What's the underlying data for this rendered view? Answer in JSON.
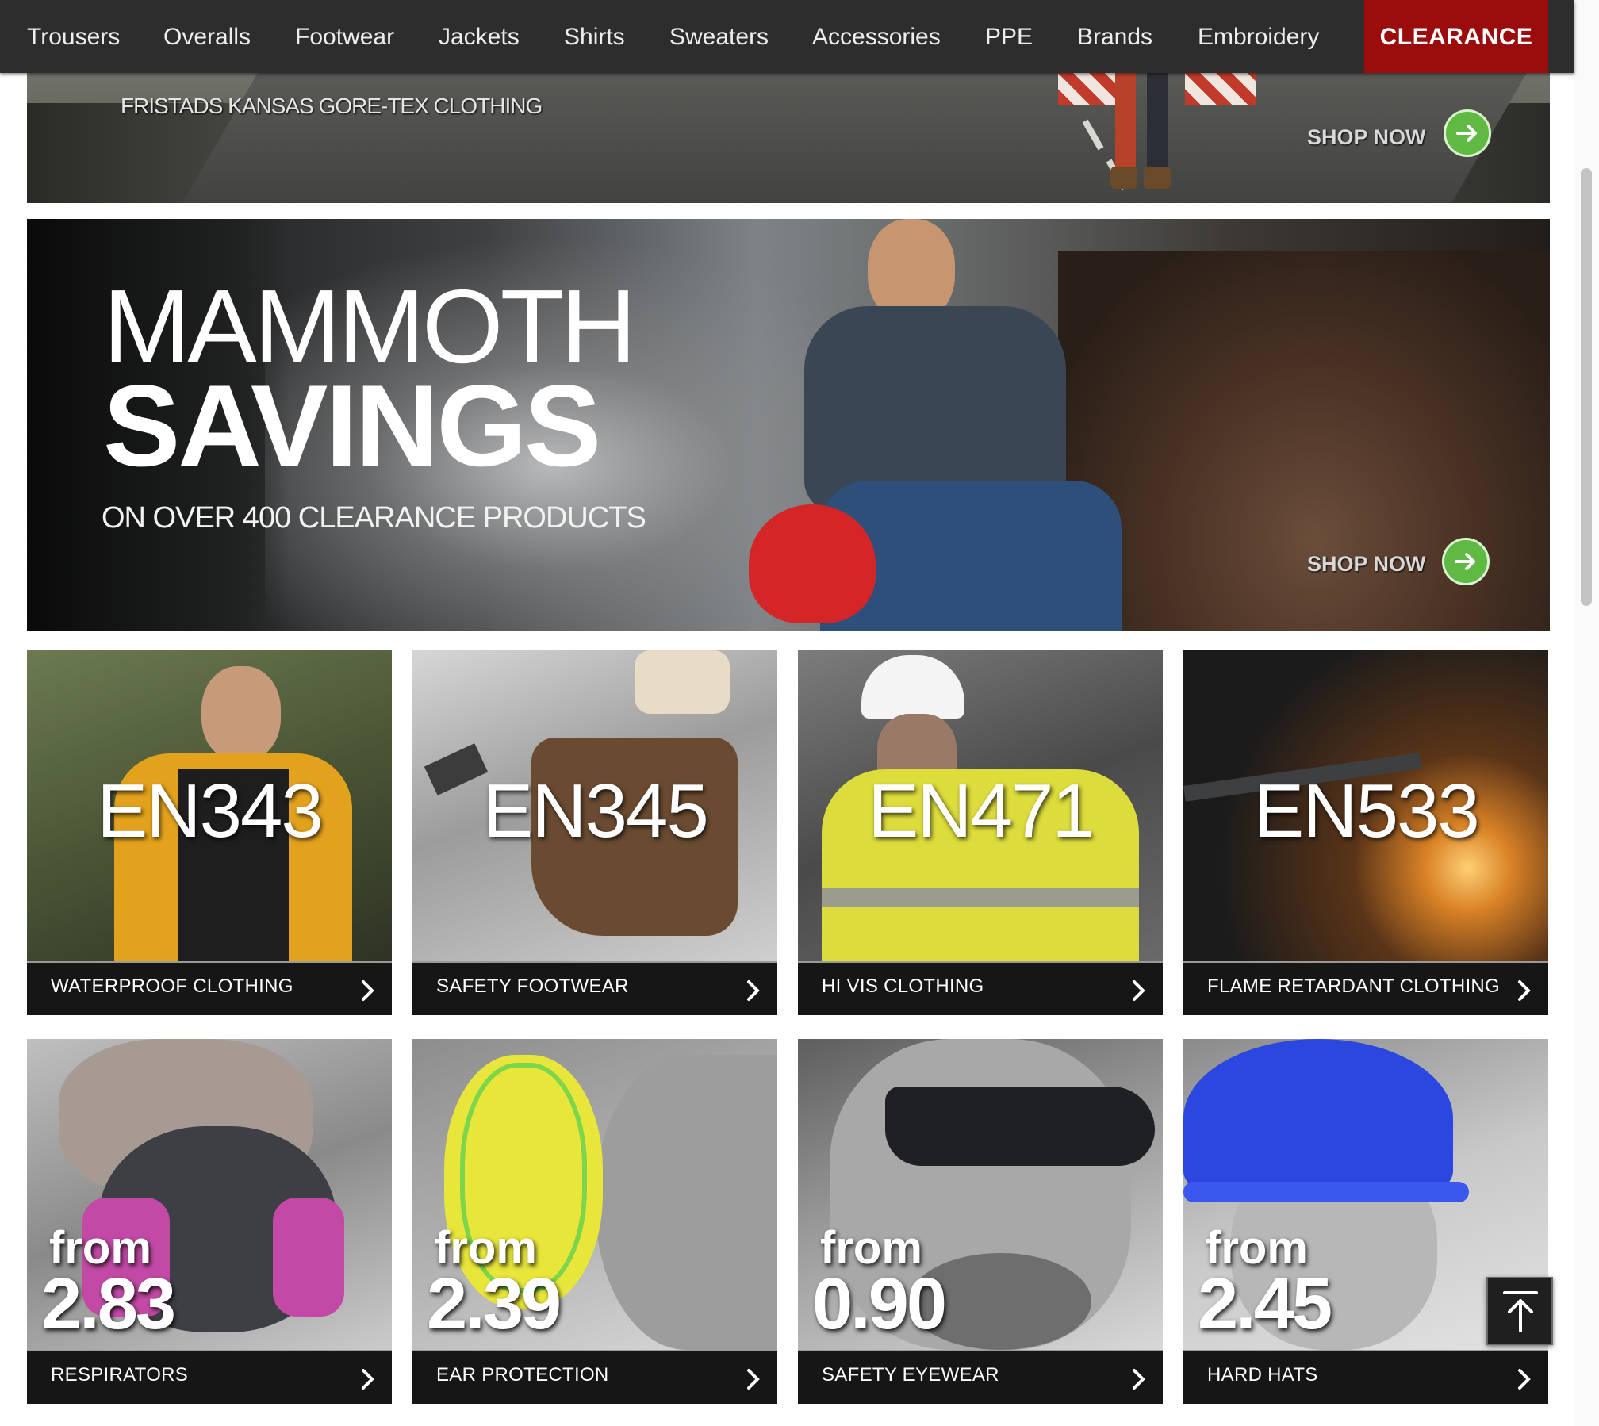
{
  "nav": {
    "items": [
      "Trousers",
      "Overalls",
      "Footwear",
      "Jackets",
      "Shirts",
      "Sweaters",
      "Accessories",
      "PPE",
      "Brands",
      "Embroidery"
    ],
    "clearance_label": "CLEARANCE",
    "colors": {
      "bar": "#2d2d2d",
      "clearance": "#9b0c0c"
    }
  },
  "banners": {
    "fristads": {
      "subtitle": "FRISTADS KANSAS GORE-TEX CLOTHING",
      "cta": "SHOP NOW"
    },
    "mammoth": {
      "title_line1": "MAMMOTH",
      "title_line2": "SAVINGS",
      "subtitle": "ON OVER 400 CLEARANCE PRODUCTS",
      "cta": "SHOP NOW"
    }
  },
  "standards": [
    {
      "code": "EN343",
      "label": "WATERPROOF CLOTHING"
    },
    {
      "code": "EN345",
      "label": "SAFETY FOOTWEAR"
    },
    {
      "code": "EN471",
      "label": "HI VIS CLOTHING"
    },
    {
      "code": "EN533",
      "label": "FLAME RETARDANT CLOTHING"
    }
  ],
  "ppe": [
    {
      "from": "from",
      "price": "2.83",
      "label": "RESPIRATORS"
    },
    {
      "from": "from",
      "price": "2.39",
      "label": "EAR PROTECTION"
    },
    {
      "from": "from",
      "price": "0.90",
      "label": "SAFETY EYEWEAR"
    },
    {
      "from": "from",
      "price": "2.45",
      "label": "HARD HATS"
    }
  ],
  "icons": {
    "shop_now": "arrow-right-circle-icon",
    "caption": "chevron-right-icon",
    "back_to_top": "arrow-up-to-line-icon"
  }
}
